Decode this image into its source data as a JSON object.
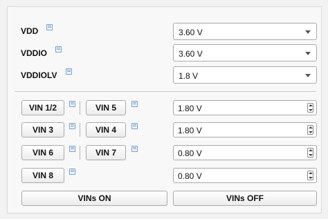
{
  "supplies": [
    {
      "label": "VDD",
      "value": "3.60 V"
    },
    {
      "label": "VDDIO",
      "value": "3.60 V"
    },
    {
      "label": "VDDIOLV",
      "value": "1.8 V"
    }
  ],
  "vins": {
    "buttons": [
      "VIN 1/2",
      "VIN 5",
      "VIN 3",
      "VIN 4",
      "VIN 6",
      "VIN 7",
      "VIN 8"
    ],
    "values": [
      "1.80 V",
      "1.80 V",
      "0.80 V",
      "0.80 V"
    ]
  },
  "actions": {
    "on": "VINs ON",
    "off": "VINs OFF"
  },
  "icons": {
    "help": "help-icon",
    "dropdown": "chevron-down-icon",
    "spinner": "spinner-icon"
  }
}
